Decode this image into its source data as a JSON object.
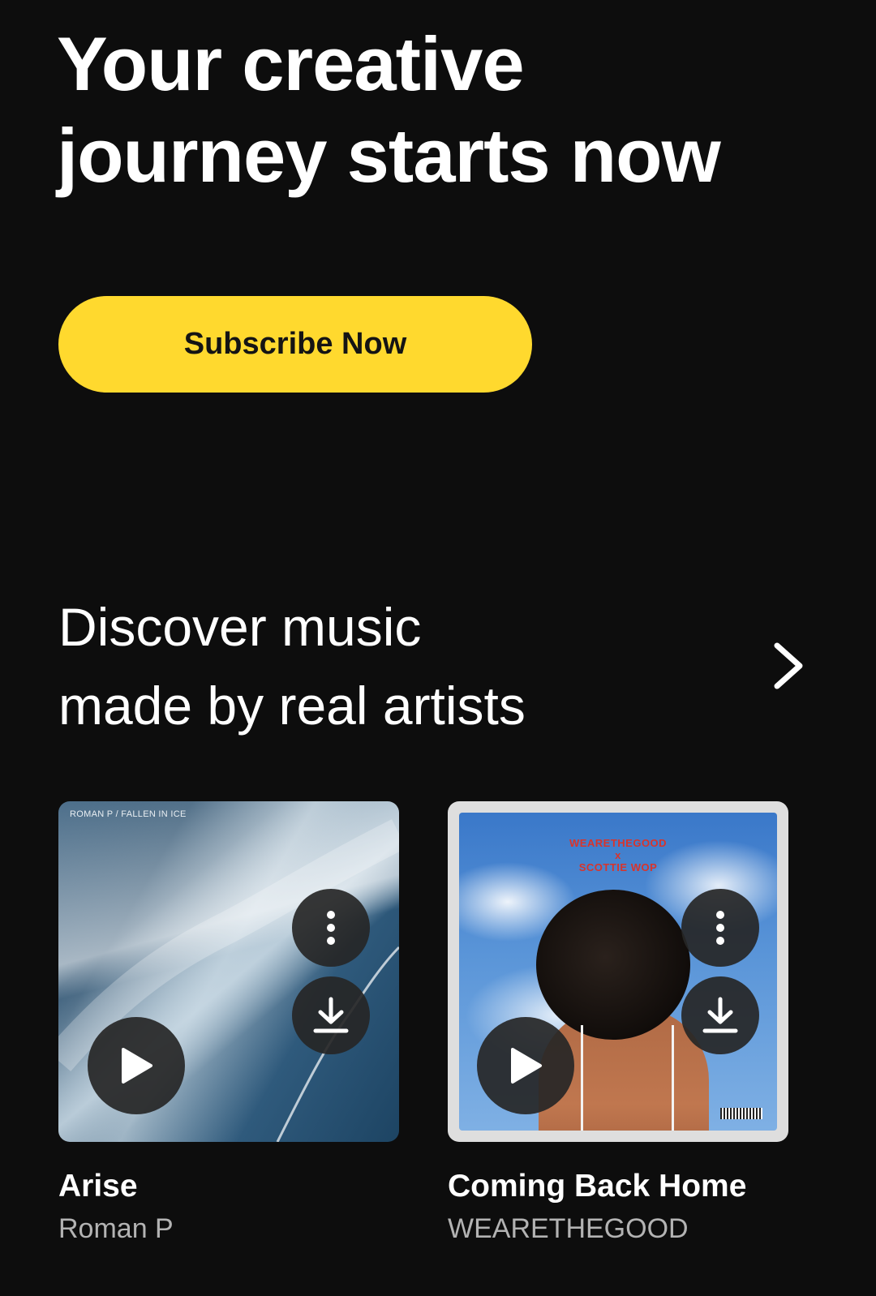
{
  "hero": {
    "title_line1": "Your creative",
    "title_line2": "journey starts now",
    "subscribe_label": "Subscribe Now"
  },
  "discover": {
    "title_line1": "Discover music",
    "title_line2": "made by real artists",
    "see_all_icon": "chevron-right-icon"
  },
  "tracks": [
    {
      "title": "Arise",
      "artist": "Roman P",
      "cover_caption": "ROMAN P / FALLEN IN ICE",
      "icons": [
        "more-vertical-icon",
        "download-icon",
        "play-icon"
      ]
    },
    {
      "title": "Coming Back Home",
      "artist": "WEARETHEGOOD",
      "cover_text_1": "WEARETHEGOOD",
      "cover_text_2": "x",
      "cover_text_3": "SCOTTIE WOP",
      "icons": [
        "more-vertical-icon",
        "download-icon",
        "play-icon"
      ]
    }
  ],
  "colors": {
    "background": "#0d0d0d",
    "accent": "#ffd92e",
    "text_primary": "#ffffff",
    "text_secondary": "#b3b3b3"
  }
}
